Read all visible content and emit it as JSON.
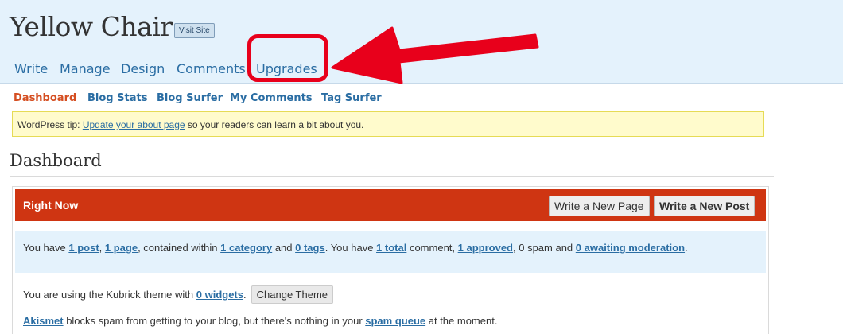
{
  "header": {
    "site_title": "Yellow Chair",
    "visit_site_label": "Visit Site",
    "nav": [
      "Write",
      "Manage",
      "Design",
      "Comments",
      "Upgrades"
    ]
  },
  "sub_nav": [
    "Dashboard",
    "Blog Stats",
    "Blog Surfer",
    "My Comments",
    "Tag Surfer"
  ],
  "tip": {
    "prefix": "WordPress tip: ",
    "link": "Update your about page",
    "suffix": " so your readers can learn a bit about you."
  },
  "page_title": "Dashboard",
  "right_now": {
    "title": "Right Now",
    "write_page_label": "Write a New Page",
    "write_post_label": "Write a New Post",
    "summary": {
      "t1": "You have ",
      "posts": "1 post",
      "t2": ", ",
      "pages": "1 page",
      "t3": ", contained within ",
      "categories": "1 category",
      "t4": " and ",
      "tags": "0 tags",
      "t5": ". You have ",
      "total": "1 total",
      "t6": " comment, ",
      "approved": "1 approved",
      "t7": ", 0 spam and ",
      "awaiting": "0 awaiting moderation",
      "t8": "."
    },
    "theme_line": {
      "t1": "You are using the Kubrick theme with ",
      "widgets": "0 widgets",
      "t2": ".",
      "change_theme_label": "Change Theme"
    },
    "akismet_line": {
      "akismet": "Akismet",
      "t1": " blocks spam from getting to your blog, but there's nothing in your ",
      "spam_queue": "spam queue",
      "t2": " at the moment."
    }
  },
  "annotation": {
    "color": "#e8001b"
  }
}
